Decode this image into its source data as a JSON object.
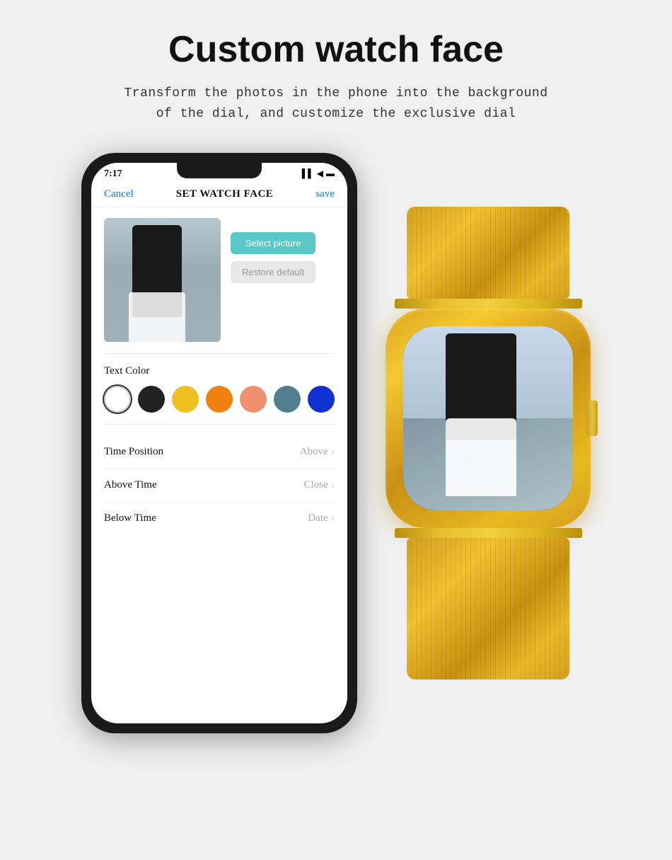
{
  "page": {
    "title": "Custom watch face",
    "subtitle_line1": "Transform the photos in the phone into the background",
    "subtitle_line2": "of the dial, and customize the exclusive dial"
  },
  "phone": {
    "status_bar": {
      "time": "7:17",
      "signal": "▌▌",
      "wifi": "◀",
      "battery": "▬"
    },
    "header": {
      "cancel": "Cancel",
      "title": "SET WATCH FACE",
      "save": "save"
    },
    "buttons": {
      "select_picture": "Select picture",
      "restore_default": "Restore default"
    },
    "text_color": {
      "label": "Text Color",
      "colors": [
        {
          "name": "white",
          "hex": "#ffffff",
          "selected": true
        },
        {
          "name": "black",
          "hex": "#222222",
          "selected": false
        },
        {
          "name": "yellow",
          "hex": "#f0c020",
          "selected": false
        },
        {
          "name": "orange",
          "hex": "#f08010",
          "selected": false
        },
        {
          "name": "peach",
          "hex": "#f09070",
          "selected": false
        },
        {
          "name": "teal",
          "hex": "#508090",
          "selected": false
        },
        {
          "name": "blue",
          "hex": "#1030d0",
          "selected": false
        }
      ]
    },
    "settings": [
      {
        "label": "Time Position",
        "value": "Above",
        "id": "time-position"
      },
      {
        "label": "Above Time",
        "value": "Close",
        "id": "above-time"
      },
      {
        "label": "Below Time",
        "value": "Date",
        "id": "below-time"
      }
    ]
  }
}
